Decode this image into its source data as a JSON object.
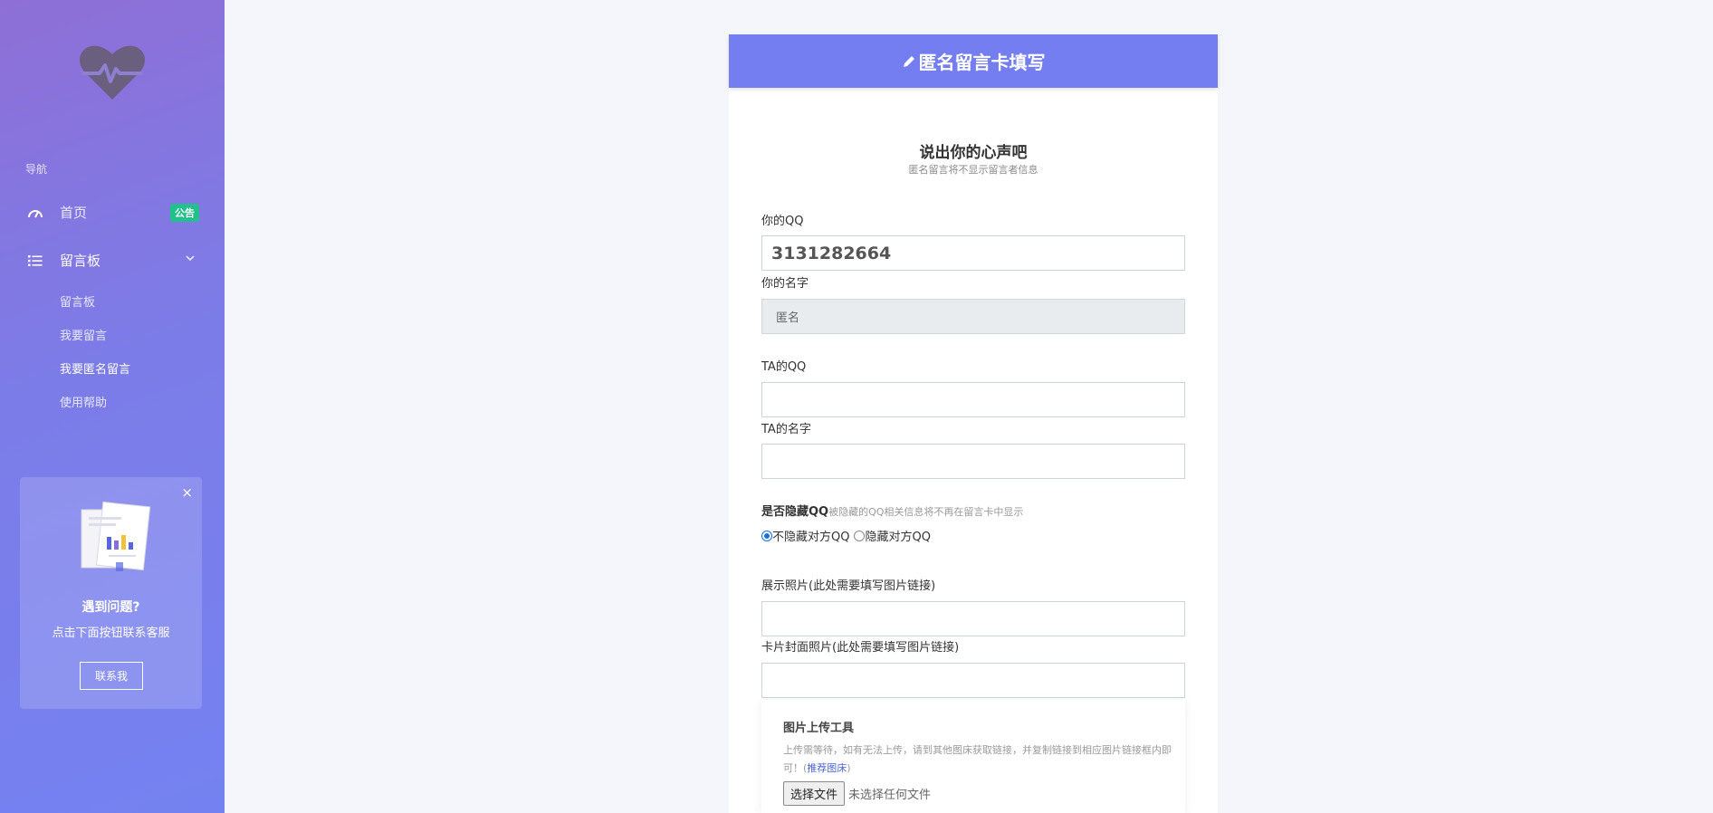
{
  "sidebar": {
    "nav_heading": "导航",
    "home": {
      "label": "首页",
      "badge": "公告"
    },
    "board": {
      "label": "留言板"
    },
    "sub_items": [
      "留言板",
      "我要留言",
      "我要匿名留言",
      "使用帮助"
    ],
    "help": {
      "title": "遇到问题?",
      "subtitle": "点击下面按钮联系客服",
      "button": "联系我",
      "close": "×"
    }
  },
  "card": {
    "header": "匿名留言卡填写",
    "section_title": "说出你的心声吧",
    "section_sub": "匿名留言将不显示留言者信息"
  },
  "form": {
    "my_qq_label": "你的QQ",
    "my_qq_value": "3131282664",
    "my_name_label": "你的名字",
    "my_name_value": "匿名",
    "ta_qq_label": "TA的QQ",
    "ta_name_label": "TA的名字",
    "hide_qq_label": "是否隐藏QQ",
    "hide_qq_hint": "被隐藏的QQ相关信息将不再在留言卡中显示",
    "radio_show": "不隐藏对方QQ",
    "radio_hide": "隐藏对方QQ",
    "photo_label": "展示照片(此处需要填写图片链接)",
    "cover_label": "卡片封面照片(此处需要填写图片链接)"
  },
  "upload": {
    "title": "图片上传工具",
    "desc": "上传需等待，如有无法上传，请到其他图床获取链接，并复制链接到相应图片链接框内即可！(",
    "link": "推荐图床",
    "desc_end": ")",
    "file_button": "选择文件",
    "file_status": "未选择任何文件"
  },
  "colors": {
    "header": "#747ef0",
    "badge": "#22c08b",
    "sidebar_top": "#8e6fd6",
    "sidebar_bottom": "#7482f1"
  }
}
